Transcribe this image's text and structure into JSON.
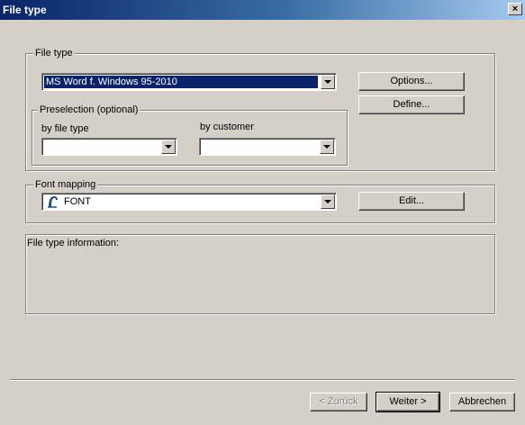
{
  "window": {
    "title": "File type",
    "close_glyph": "×"
  },
  "file_type_group": {
    "legend": "File type",
    "selected": "MS Word f. Windows 95-2010",
    "options_button": "Options...",
    "define_button": "Define..."
  },
  "preselection": {
    "legend": "Preselection (optional)",
    "by_file_type_label": "by file type",
    "by_file_type_value": "",
    "by_customer_label": "by customer",
    "by_customer_value": ""
  },
  "font_mapping": {
    "legend": "Font mapping",
    "selected": "FONT",
    "icon": "font-icon",
    "edit_button": "Edit..."
  },
  "info": {
    "label": "File type information:"
  },
  "footer": {
    "back_button": "< Zurück",
    "next_button": "Weiter >",
    "cancel_button": "Abbrechen"
  },
  "colors": {
    "face": "#d4d0c8",
    "title_start": "#0a246a",
    "title_end": "#a6caf0",
    "selection": "#0a246a"
  }
}
